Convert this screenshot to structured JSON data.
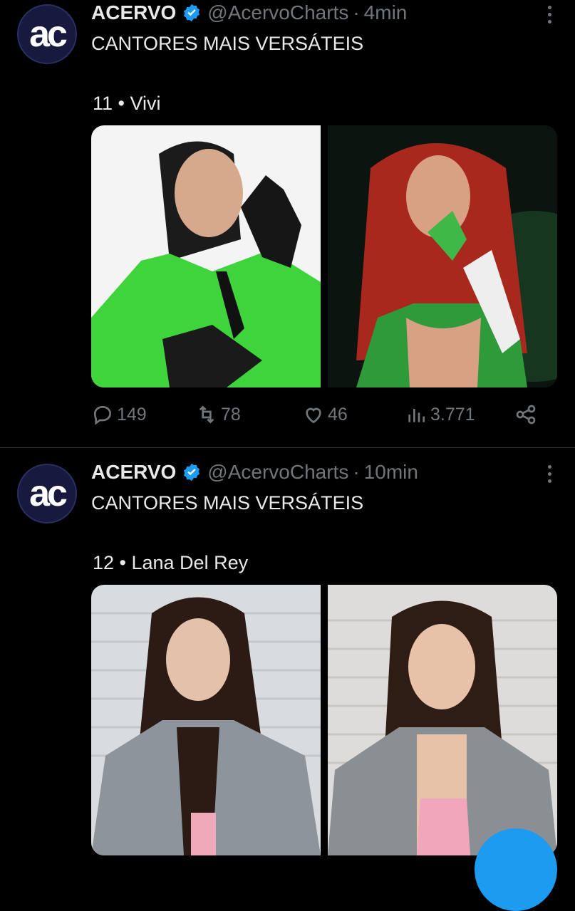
{
  "tweets": [
    {
      "account": {
        "name": "ACERVO",
        "handle": "@AcervoCharts",
        "avatar_text": "ac"
      },
      "time": "4min",
      "separator": "·",
      "title": "CANTORES MAIS VERSÁTEIS",
      "subtitle": "11 • Vivi",
      "stats": {
        "replies": "149",
        "retweets": "78",
        "likes": "46",
        "views": "3.771"
      }
    },
    {
      "account": {
        "name": "ACERVO",
        "handle": "@AcervoCharts",
        "avatar_text": "ac"
      },
      "time": "10min",
      "separator": "·",
      "title": "CANTORES MAIS VERSÁTEIS",
      "subtitle": "12 • Lana Del Rey"
    }
  ],
  "icons": {
    "verified": "verified-badge-icon",
    "reply": "reply-icon",
    "retweet": "retweet-icon",
    "like": "heart-icon",
    "views": "views-icon",
    "share": "share-icon",
    "more": "more-icon"
  },
  "colors": {
    "background": "#000000",
    "text": "#e7e9ea",
    "muted": "#71767b",
    "accent": "#1d9bf0"
  }
}
